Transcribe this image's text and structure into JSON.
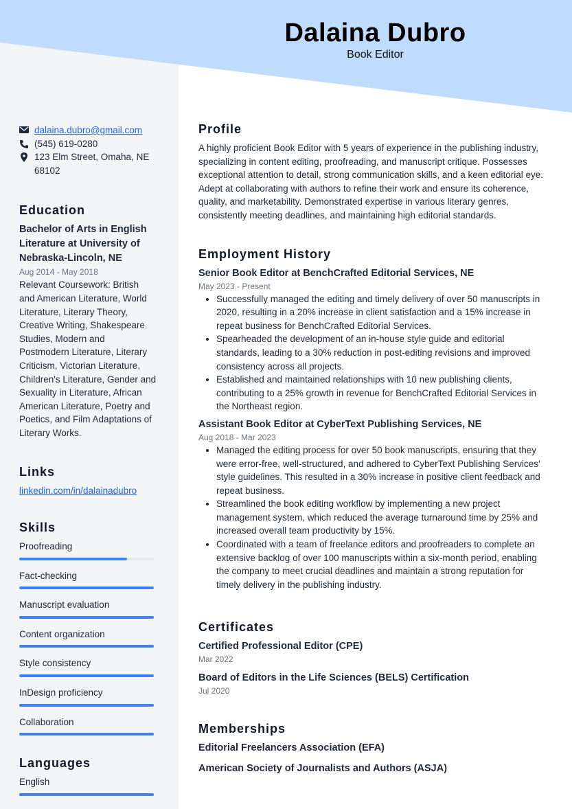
{
  "colors": {
    "banner": "#bfdbfe",
    "sidebar": "#f3f4f6",
    "accent": "#3b82f6"
  },
  "header": {
    "name": "Dalaina Dubro",
    "title": "Book Editor"
  },
  "contact": {
    "email": "dalaina.dubro@gmail.com",
    "phone": "(545) 619-0280",
    "address": "123 Elm Street, Omaha, NE 68102"
  },
  "education": {
    "heading": "Education",
    "degree": "Bachelor of Arts in English Literature at University of Nebraska-Lincoln, NE",
    "dates": "Aug 2014 - May 2018",
    "description": "Relevant Coursework: British and American Literature, World Literature, Literary Theory, Creative Writing, Shakespeare Studies, Modern and Postmodern Literature, Literary Criticism, Victorian Literature, Children's Literature, Gender and Sexuality in Literature, African American Literature, Poetry and Poetics, and Film Adaptations of Literary Works."
  },
  "links": {
    "heading": "Links",
    "items": [
      "linkedin.com/in/dalainadubro"
    ]
  },
  "skills": {
    "heading": "Skills",
    "items": [
      {
        "label": "Proofreading",
        "level": 80
      },
      {
        "label": "Fact-checking",
        "level": 100
      },
      {
        "label": "Manuscript evaluation",
        "level": 100
      },
      {
        "label": "Content organization",
        "level": 100
      },
      {
        "label": "Style consistency",
        "level": 100
      },
      {
        "label": "InDesign proficiency",
        "level": 100
      },
      {
        "label": "Collaboration",
        "level": 100
      }
    ]
  },
  "languages": {
    "heading": "Languages",
    "items": [
      {
        "label": "English",
        "level": 100
      }
    ]
  },
  "profile": {
    "heading": "Profile",
    "text": "A highly proficient Book Editor with 5 years of experience in the publishing industry, specializing in content editing, proofreading, and manuscript critique. Possesses exceptional attention to detail, strong communication skills, and a keen editorial eye. Adept at collaborating with authors to refine their work and ensure its coherence, quality, and marketability. Demonstrated expertise in various literary genres, consistently meeting deadlines, and maintaining high editorial standards."
  },
  "employment": {
    "heading": "Employment History",
    "jobs": [
      {
        "title": "Senior Book Editor at BenchCrafted Editorial Services, NE",
        "dates": "May 2023 - Present",
        "bullets": [
          "Successfully managed the editing and timely delivery of over 50 manuscripts in 2020, resulting in a 20% increase in client satisfaction and a 15% increase in repeat business for BenchCrafted Editorial Services.",
          "Spearheaded the development of an in-house style guide and editorial standards, leading to a 30% reduction in post-editing revisions and improved consistency across all projects.",
          "Established and maintained relationships with 10 new publishing clients, contributing to a 25% growth in revenue for BenchCrafted Editorial Services in the Northeast region."
        ]
      },
      {
        "title": "Assistant Book Editor at CyberText Publishing Services, NE",
        "dates": "Aug 2018 - Mar 2023",
        "bullets": [
          "Managed the editing process for over 50 book manuscripts, ensuring that they were error-free, well-structured, and adhered to CyberText Publishing Services' style guidelines. This resulted in a 30% increase in positive client feedback and repeat business.",
          "Streamlined the book editing workflow by implementing a new project management system, which reduced the average turnaround time by 25% and increased overall team productivity by 15%.",
          "Coordinated with a team of freelance editors and proofreaders to complete an extensive backlog of over 100 manuscripts within a six-month period, enabling the company to meet crucial deadlines and maintain a strong reputation for timely delivery in the publishing industry."
        ]
      }
    ]
  },
  "certificates": {
    "heading": "Certificates",
    "items": [
      {
        "title": "Certified Professional Editor (CPE)",
        "date": "Mar 2022"
      },
      {
        "title": "Board of Editors in the Life Sciences (BELS) Certification",
        "date": "Jul 2020"
      }
    ]
  },
  "memberships": {
    "heading": "Memberships",
    "items": [
      "Editorial Freelancers Association (EFA)",
      "American Society of Journalists and Authors (ASJA)"
    ]
  }
}
